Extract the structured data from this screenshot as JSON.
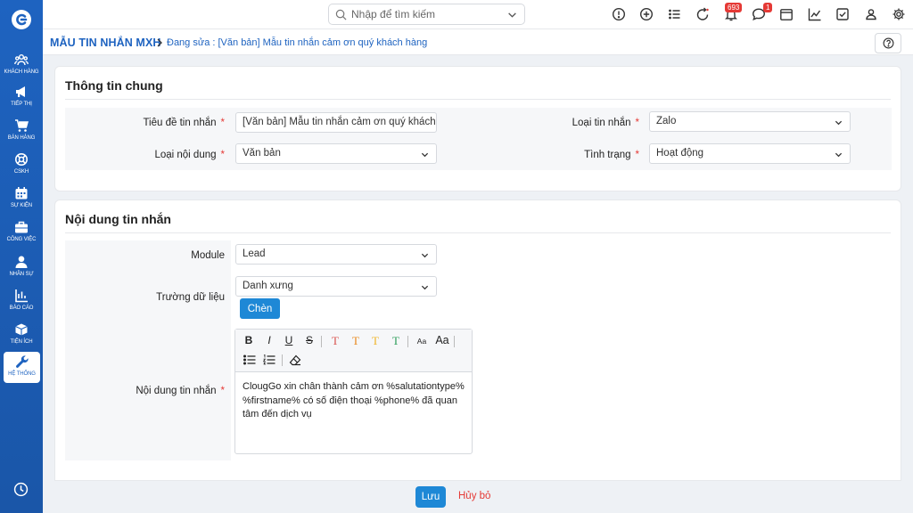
{
  "sidebar": {
    "items": [
      {
        "label": "KHÁCH HÀNG",
        "icon": "users-icon"
      },
      {
        "label": "TIẾP THỊ",
        "icon": "megaphone-icon"
      },
      {
        "label": "BÁN HÀNG",
        "icon": "cart-icon"
      },
      {
        "label": "CSKH",
        "icon": "lifebuoy-icon"
      },
      {
        "label": "SỰ KIỆN",
        "icon": "calendar-icon"
      },
      {
        "label": "CÔNG VIỆC",
        "icon": "briefcase-icon"
      },
      {
        "label": "NHÂN SỰ",
        "icon": "person-icon"
      },
      {
        "label": "BÁO CÁO",
        "icon": "chart-icon"
      },
      {
        "label": "TIỆN ÍCH",
        "icon": "box-icon"
      },
      {
        "label": "HỆ THỐNG",
        "icon": "wrench-icon"
      }
    ]
  },
  "topbar": {
    "search_placeholder": "Nhập để tìm kiếm",
    "notification_count": "693",
    "message_count": "1"
  },
  "breadcrumb": {
    "title": "MẪU TIN NHẮN MXH",
    "subtitle": "Đang sửa : [Văn bản] Mẫu tin nhắn cảm ơn quý khách hàng"
  },
  "general": {
    "section_title": "Thông tin chung",
    "title_label": "Tiêu đề tin nhắn",
    "title_value": "[Văn bản] Mẫu tin nhắn cảm ơn quý khách",
    "content_type_label": "Loại nội dung",
    "content_type_value": "Văn bản",
    "message_type_label": "Loại tin nhắn",
    "message_type_value": "Zalo",
    "status_label": "Tình trạng",
    "status_value": "Hoạt động",
    "required_mark": "*"
  },
  "content": {
    "section_title": "Nội dung tin nhắn",
    "module_label": "Module",
    "module_value": "Lead",
    "field_label": "Trường dữ liệu",
    "field_value": "Danh xưng",
    "insert_button": "Chèn",
    "body_label": "Nội dung tin nhắn",
    "body_text": "ClougGo xin chân thành cảm ơn %salutationtype% %firstname% có số điện thoại %phone% đã quan tâm đến dịch vụ",
    "toolbar": {
      "bold": "B",
      "italic": "I",
      "underline": "U",
      "strike": "S",
      "text_color_1": "T",
      "text_color_2": "T",
      "text_color_3": "T",
      "text_color_4": "T",
      "font_size_small": "Aa",
      "font_size_large": "Aa"
    },
    "text_colors": [
      "#d9534f",
      "#e8891d",
      "#f0b429",
      "#2e9e5b"
    ]
  },
  "footer": {
    "save_button": "Lưu",
    "cancel_button": "Hủy bỏ"
  },
  "colors": {
    "brand": "#1e63c0",
    "primary_button": "#1e88d6",
    "danger": "#e53935"
  }
}
